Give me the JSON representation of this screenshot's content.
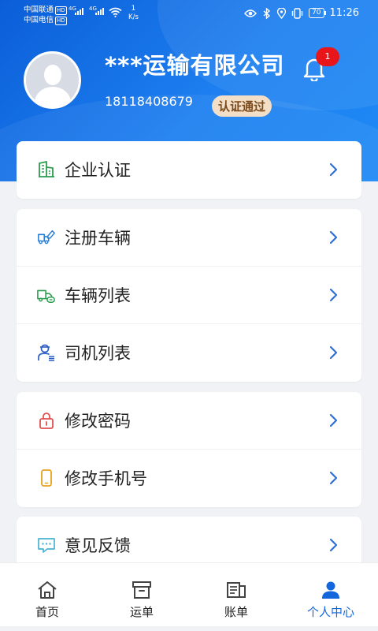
{
  "status_bar": {
    "carrier1": "中国联通",
    "carrier2": "中国电信",
    "hd": "HD",
    "net": "4G",
    "speed_value": "1",
    "speed_unit": "K/s",
    "battery": "70",
    "time": "11:26"
  },
  "profile": {
    "company_name": "***运输有限公司",
    "phone": "18118408679",
    "certified_badge": "认证通过",
    "notification_count": "1"
  },
  "menu": {
    "enterprise_cert": "企业认证",
    "register_vehicle": "注册车辆",
    "vehicle_list": "车辆列表",
    "driver_list": "司机列表",
    "change_password": "修改密码",
    "change_phone": "修改手机号",
    "feedback": "意见反馈"
  },
  "tabbar": {
    "home": "首页",
    "waybill": "运单",
    "bill": "账单",
    "profile": "个人中心"
  },
  "colors": {
    "primary": "#1366dc",
    "header_gradient_start": "#0b5ed8",
    "header_gradient_end": "#1e8af5",
    "badge_bg": "#f3dfc7",
    "notification_red": "#e8161b"
  }
}
